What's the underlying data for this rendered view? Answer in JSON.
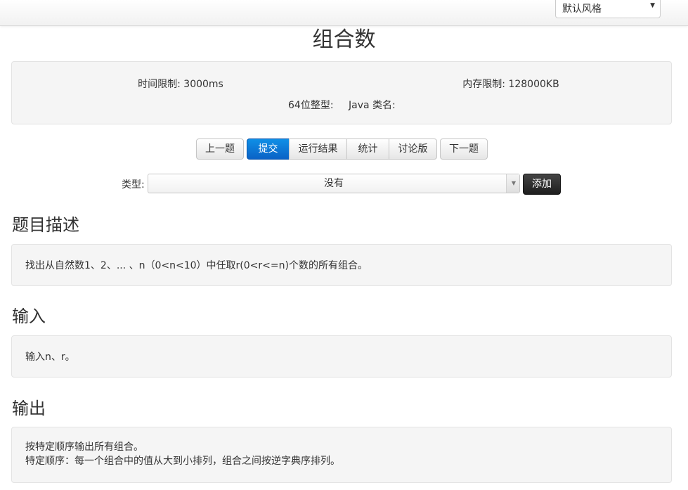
{
  "topbar": {
    "style_select": {
      "value": "默认风格"
    }
  },
  "problem": {
    "title": "组合数",
    "time_limit": "时间限制: 3000ms",
    "memory_limit": "内存限制: 128000KB",
    "int64": "64位整型:",
    "java_class": "Java 类名:"
  },
  "actions": {
    "prev": "上一题",
    "submit": "提交",
    "results": "运行结果",
    "stats": "统计",
    "discuss": "讨论版",
    "next": "下一题"
  },
  "type_row": {
    "label": "类型:",
    "selected": "没有",
    "add": "添加"
  },
  "sections": {
    "description": {
      "heading": "题目描述",
      "lines": [
        "找出从自然数1、2、... 、n（0<n<10）中任取r(0<r<=n)个数的所有组合。"
      ]
    },
    "input": {
      "heading": "输入",
      "lines": [
        "输入n、r。"
      ]
    },
    "output": {
      "heading": "输出",
      "lines": [
        "按特定顺序输出所有组合。",
        "特定顺序：每一个组合中的值从大到小排列，组合之间按逆字典序排列。"
      ]
    }
  }
}
